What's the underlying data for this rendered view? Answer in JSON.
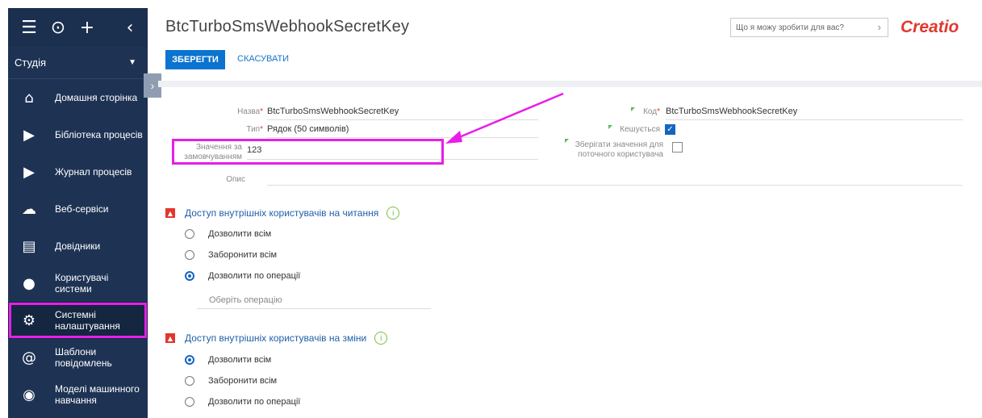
{
  "sidebar": {
    "studio_label": "Студія",
    "items": [
      {
        "label": "Домашня сторінка",
        "icon": "home-icon",
        "glyph": "⌂"
      },
      {
        "label": "Бібліотека процесів",
        "icon": "process-library-icon",
        "glyph": "▶"
      },
      {
        "label": "Журнал процесів",
        "icon": "process-log-icon",
        "glyph": "▶"
      },
      {
        "label": "Веб-сервіси",
        "icon": "cloud-icon",
        "glyph": "☁"
      },
      {
        "label": "Довідники",
        "icon": "lookups-icon",
        "glyph": "▤"
      },
      {
        "label": "Користувачі системи",
        "icon": "users-icon",
        "glyph": "●"
      },
      {
        "label": "Системні налаштування",
        "icon": "system-settings-icon",
        "glyph": "⚙"
      },
      {
        "label": "Шаблони повідомлень",
        "icon": "email-templates-icon",
        "glyph": "@"
      },
      {
        "label": "Моделі машинного навчання",
        "icon": "ml-models-icon",
        "glyph": "◉"
      }
    ]
  },
  "header": {
    "title": "BtcTurboSmsWebhookSecretKey",
    "search_placeholder": "Що я можу зробити для вас?",
    "logo": "Creatio",
    "save_label": "ЗБЕРЕГТИ",
    "cancel_label": "СКАСУВАТИ"
  },
  "form": {
    "name_label": "Назва",
    "name_value": "BtcTurboSmsWebhookSecretKey",
    "type_label": "Тип",
    "type_value": "Рядок (50 символів)",
    "default_label_1": "Значення за",
    "default_label_2": "замовчуванням",
    "default_value": "123",
    "description_label": "Опис",
    "code_label": "Код",
    "code_value": "BtcTurboSmsWebhookSecretKey",
    "cached_label": "Кешується",
    "cached_checked": true,
    "per_user_label_1": "Зберігати значення для",
    "per_user_label_2": "поточного користувача",
    "per_user_checked": false
  },
  "read_access": {
    "title": "Доступ внутрішніх користувачів на читання",
    "options": [
      "Дозволити всім",
      "Заборонити всім",
      "Дозволити по операції"
    ],
    "selected": 2,
    "operation_placeholder": "Оберіть операцію"
  },
  "write_access": {
    "title": "Доступ внутрішніх користувачів на зміни",
    "options": [
      "Дозволити всім",
      "Заборонити всім",
      "Дозволити по операції"
    ],
    "selected": 0
  },
  "colors": {
    "sidebar_bg": "#1e3354",
    "accent": "#0b73d0",
    "highlight": "#e81ee8",
    "brand": "#e0382e"
  }
}
